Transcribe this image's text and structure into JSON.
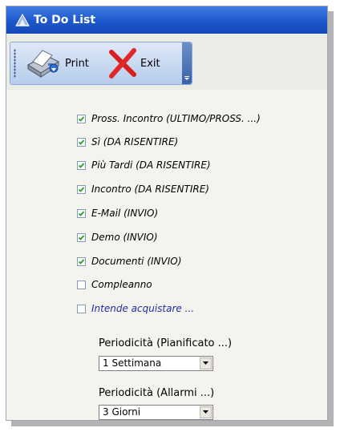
{
  "window": {
    "title": "To Do List"
  },
  "toolbar": {
    "print_label": "Print",
    "exit_label": "Exit"
  },
  "checklist": [
    {
      "label": "Pross. Incontro  (ULTIMO/PROSS. ...)",
      "checked": true
    },
    {
      "label": "Sì  (DA RISENTIRE)",
      "checked": true
    },
    {
      "label": "Più Tardi  (DA RISENTIRE)",
      "checked": true
    },
    {
      "label": "Incontro  (DA RISENTIRE)",
      "checked": true
    },
    {
      "label": "E-Mail  (INVIO)",
      "checked": true
    },
    {
      "label": "Demo  (INVIO)",
      "checked": true
    },
    {
      "label": "Documenti  (INVIO)",
      "checked": true
    },
    {
      "label": "Compleanno",
      "checked": false
    },
    {
      "label": "Intende acquistare ...",
      "checked": false,
      "color": "#1e2d9c"
    }
  ],
  "periodicity_planned": {
    "label": "Periodicità (Pianificato ...)",
    "value": "1 Settimana"
  },
  "periodicity_alarms": {
    "label": "Periodicità (Allarmi ...)",
    "value": "3 Giorni"
  }
}
